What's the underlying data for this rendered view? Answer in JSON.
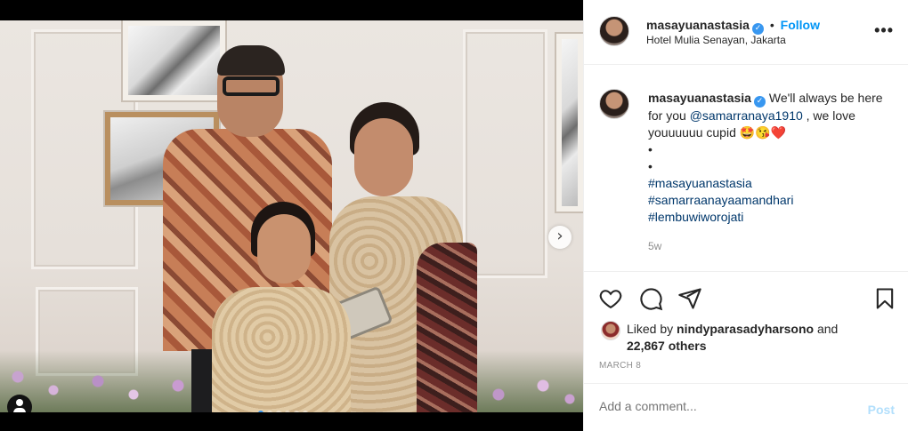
{
  "post": {
    "username": "masayuanastasia",
    "follow_label": "Follow",
    "location": "Hotel Mulia Senayan, Jakarta",
    "more_icon": "more-options-icon",
    "carousel": {
      "total": 6,
      "active": 0
    }
  },
  "caption": {
    "username": "masayuanastasia",
    "text_before": " We'll always be here for you ",
    "mention": "@samarranaya1910",
    "text_after": " , we love youuuuuu cupid ",
    "emoji": "🤩😘❤️",
    "bullet1": "•",
    "bullet2": "•",
    "hashtags": [
      "#masayuanastasia",
      "#samarraanayaamandhari",
      "#lembuwiworojati"
    ],
    "time_ago": "5w"
  },
  "actions": {
    "like_icon": "heart-icon",
    "comment_icon": "comment-icon",
    "share_icon": "share-icon",
    "save_icon": "bookmark-icon"
  },
  "likes": {
    "prefix": "Liked by ",
    "liker": "nindyparasadyharsono",
    "and": " and",
    "others": "22,867 others"
  },
  "date": "MARCH 8",
  "comment_box": {
    "placeholder": "Add a comment...",
    "post_label": "Post"
  },
  "colors": {
    "link": "#00376b",
    "accent": "#0095f6",
    "muted": "#8e8e8e"
  }
}
